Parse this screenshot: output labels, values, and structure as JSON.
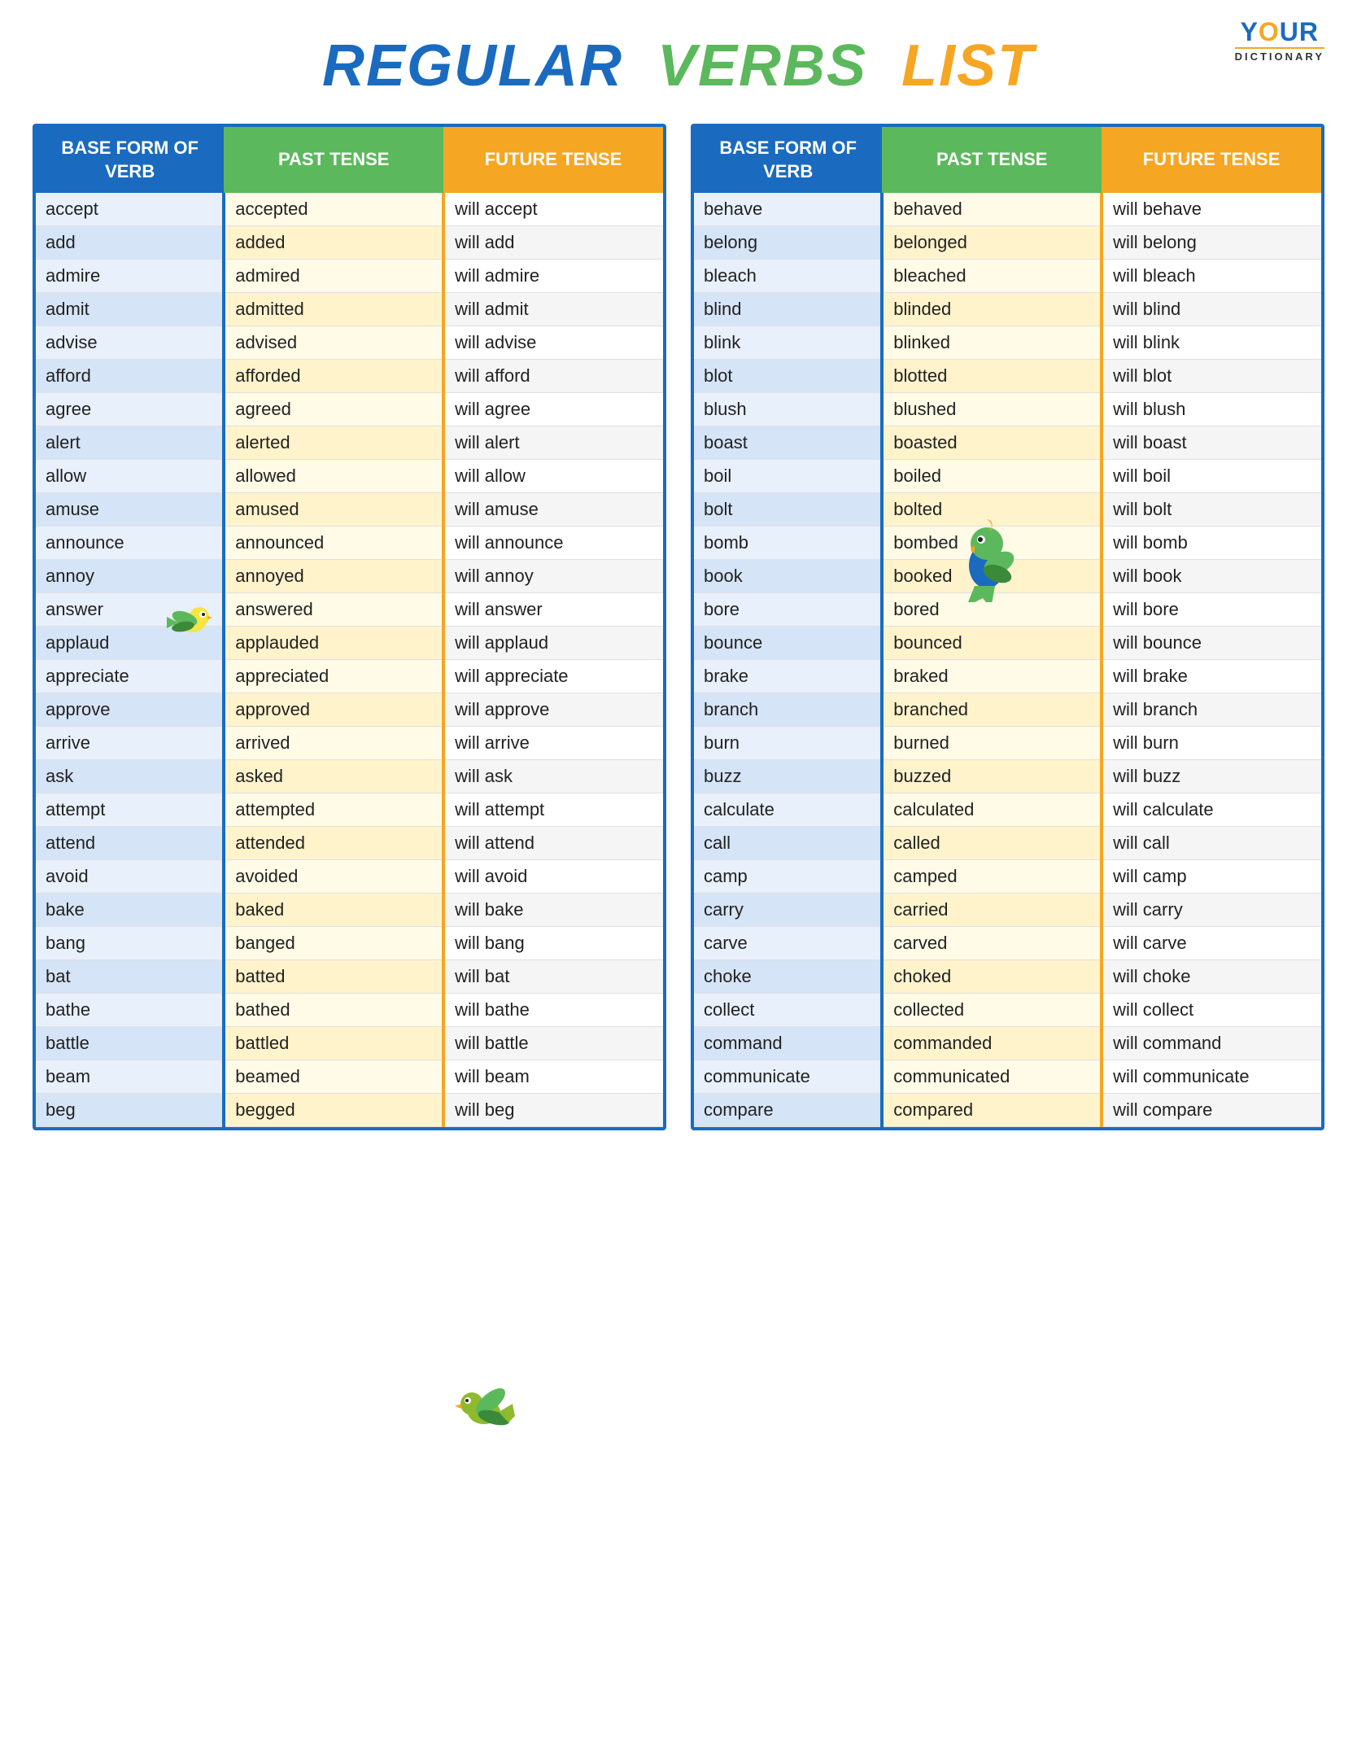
{
  "logo": {
    "your": "YOUR",
    "dictionary": "DICTIONARY"
  },
  "title": {
    "regular": "REGULAR",
    "verbs": "VERBS",
    "list": "LIST"
  },
  "headers": {
    "base": "BASE FORM OF VERB",
    "past": "PAST TENSE",
    "future": "FUTURE TENSE"
  },
  "left_table": [
    [
      "accept",
      "accepted",
      "will accept"
    ],
    [
      "add",
      "added",
      "will add"
    ],
    [
      "admire",
      "admired",
      "will admire"
    ],
    [
      "admit",
      "admitted",
      "will admit"
    ],
    [
      "advise",
      "advised",
      "will advise"
    ],
    [
      "afford",
      "afforded",
      "will afford"
    ],
    [
      "agree",
      "agreed",
      "will agree"
    ],
    [
      "alert",
      "alerted",
      "will alert"
    ],
    [
      "allow",
      "allowed",
      "will allow"
    ],
    [
      "amuse",
      "amused",
      "will amuse"
    ],
    [
      "announce",
      "announced",
      "will announce"
    ],
    [
      "annoy",
      "annoyed",
      "will annoy"
    ],
    [
      "answer",
      "answered",
      "will answer"
    ],
    [
      "applaud",
      "applauded",
      "will applaud"
    ],
    [
      "appreciate",
      "appreciated",
      "will appreciate"
    ],
    [
      "approve",
      "approved",
      "will approve"
    ],
    [
      "arrive",
      "arrived",
      "will arrive"
    ],
    [
      "ask",
      "asked",
      "will ask"
    ],
    [
      "attempt",
      "attempted",
      "will attempt"
    ],
    [
      "attend",
      "attended",
      "will attend"
    ],
    [
      "avoid",
      "avoided",
      "will avoid"
    ],
    [
      "bake",
      "baked",
      "will bake"
    ],
    [
      "bang",
      "banged",
      "will bang"
    ],
    [
      "bat",
      "batted",
      "will bat"
    ],
    [
      "bathe",
      "bathed",
      "will bathe"
    ],
    [
      "battle",
      "battled",
      "will battle"
    ],
    [
      "beam",
      "beamed",
      "will beam"
    ],
    [
      "beg",
      "begged",
      "will beg"
    ]
  ],
  "right_table": [
    [
      "behave",
      "behaved",
      "will behave"
    ],
    [
      "belong",
      "belonged",
      "will belong"
    ],
    [
      "bleach",
      "bleached",
      "will bleach"
    ],
    [
      "blind",
      "blinded",
      "will blind"
    ],
    [
      "blink",
      "blinked",
      "will blink"
    ],
    [
      "blot",
      "blotted",
      "will blot"
    ],
    [
      "blush",
      "blushed",
      "will blush"
    ],
    [
      "boast",
      "boasted",
      "will boast"
    ],
    [
      "boil",
      "boiled",
      "will boil"
    ],
    [
      "bolt",
      "bolted",
      "will bolt"
    ],
    [
      "bomb",
      "bombed",
      "will bomb"
    ],
    [
      "book",
      "booked",
      "will book"
    ],
    [
      "bore",
      "bored",
      "will bore"
    ],
    [
      "bounce",
      "bounced",
      "will bounce"
    ],
    [
      "brake",
      "braked",
      "will brake"
    ],
    [
      "branch",
      "branched",
      "will branch"
    ],
    [
      "burn",
      "burned",
      "will burn"
    ],
    [
      "buzz",
      "buzzed",
      "will buzz"
    ],
    [
      "calculate",
      "calculated",
      "will calculate"
    ],
    [
      "call",
      "called",
      "will call"
    ],
    [
      "camp",
      "camped",
      "will camp"
    ],
    [
      "carry",
      "carried",
      "will carry"
    ],
    [
      "carve",
      "carved",
      "will carve"
    ],
    [
      "choke",
      "choked",
      "will choke"
    ],
    [
      "collect",
      "collected",
      "will collect"
    ],
    [
      "command",
      "commanded",
      "will command"
    ],
    [
      "communicate",
      "communicated",
      "will communicate"
    ],
    [
      "compare",
      "compared",
      "will compare"
    ]
  ]
}
